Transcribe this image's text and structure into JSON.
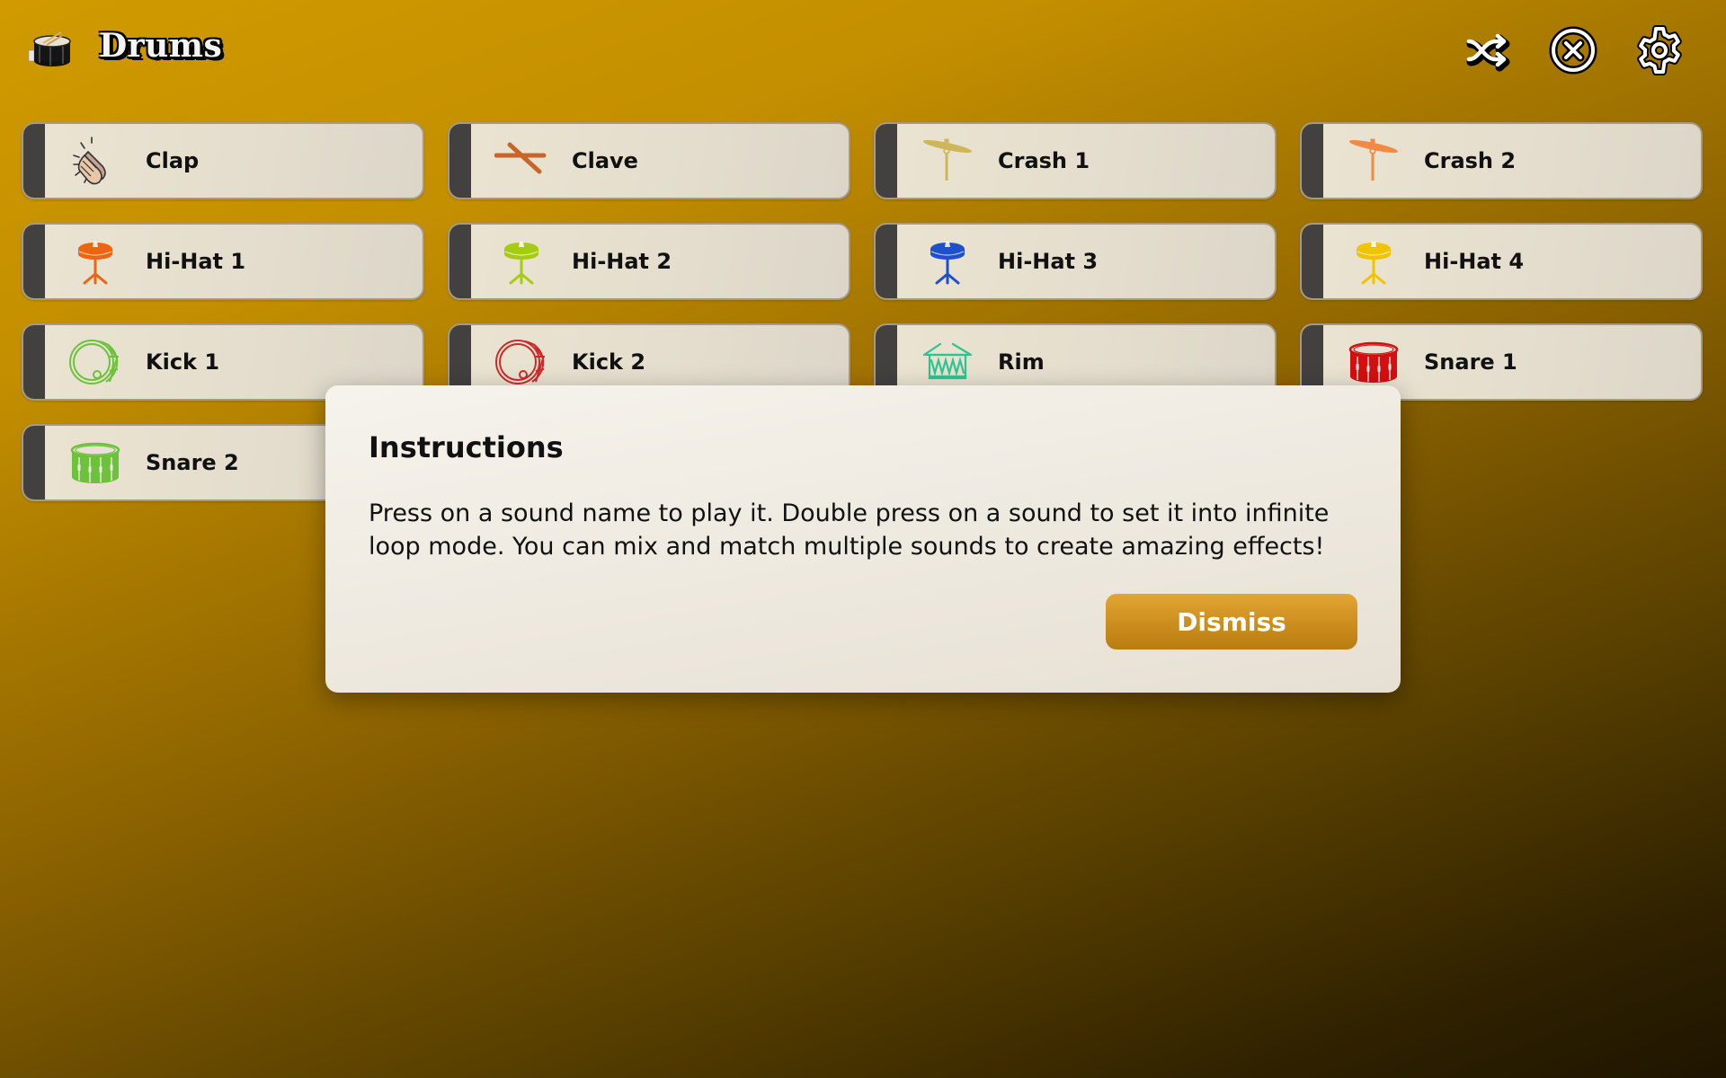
{
  "header": {
    "title": "Drums",
    "logo_icon": "snare-drum-logo",
    "buttons": [
      {
        "id": "shuffle",
        "icon": "shuffle-icon",
        "label": "Shuffle"
      },
      {
        "id": "stop",
        "icon": "close-circle-icon",
        "label": "Stop all"
      },
      {
        "id": "settings",
        "icon": "gear-icon",
        "label": "Settings"
      }
    ]
  },
  "sounds": [
    {
      "label": "Clap",
      "icon": "clapping-hands-icon",
      "color": "#e8c7a8"
    },
    {
      "label": "Clave",
      "icon": "clave-sticks-icon",
      "color": "#c8662a"
    },
    {
      "label": "Crash 1",
      "icon": "crash-cymbal-icon",
      "color": "#cdb75a"
    },
    {
      "label": "Crash 2",
      "icon": "crash-cymbal-icon",
      "color": "#f08a45"
    },
    {
      "label": "Hi-Hat 1",
      "icon": "hi-hat-icon",
      "color": "#ee6410"
    },
    {
      "label": "Hi-Hat 2",
      "icon": "hi-hat-icon",
      "color": "#a6cc10"
    },
    {
      "label": "Hi-Hat 3",
      "icon": "hi-hat-icon",
      "color": "#1e4fcc"
    },
    {
      "label": "Hi-Hat 4",
      "icon": "hi-hat-icon",
      "color": "#f0c400"
    },
    {
      "label": "Kick 1",
      "icon": "kick-drum-icon",
      "color": "#6cc23a"
    },
    {
      "label": "Kick 2",
      "icon": "kick-drum-icon",
      "color": "#cc2a2a"
    },
    {
      "label": "Rim",
      "icon": "rim-drum-icon",
      "color": "#2ec491"
    },
    {
      "label": "Snare 1",
      "icon": "snare-drum-icon",
      "color": "#d40f0f"
    },
    {
      "label": "Snare 2",
      "icon": "snare-drum-icon",
      "color": "#6cc23a"
    }
  ],
  "dialog": {
    "title": "Instructions",
    "body": "Press on a sound name to play it. Double press on a sound to set it into infinite loop mode. You can mix and match multiple sounds to create amazing effects!",
    "dismiss_label": "Dismiss"
  },
  "colors": {
    "accent": "#d09a00",
    "pad_bar": "#424140",
    "dismiss_button": "#d4961f"
  }
}
